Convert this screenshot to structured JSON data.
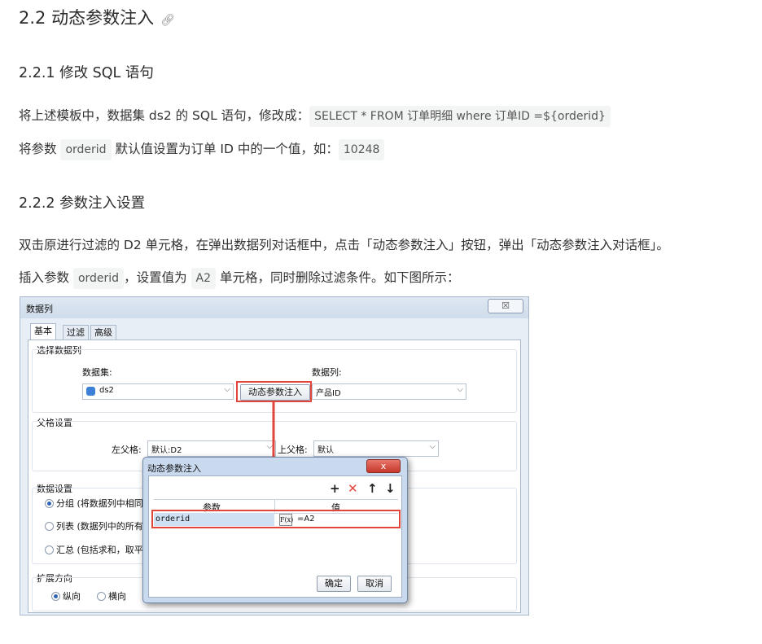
{
  "heading_2": "2.2 动态参数注入",
  "anchor_icon": "link-icon",
  "section_1": {
    "heading": "2.2.1 修改 SQL 语句",
    "line1_prefix": "将上述模板中，数据集 ds2 的 SQL 语句，修改成：",
    "line1_code": "SELECT * FROM 订单明细 where 订单ID =${orderid}",
    "line2_prefix": "将参数",
    "line2_code1": "orderid",
    "line2_middle": "默认值设置为订单 ID 中的一个值，如：",
    "line2_code2": "10248"
  },
  "section_2": {
    "heading": "2.2.2 参数注入设置",
    "line1": "双击原进行过滤的 D2 单元格，在弹出数据列对话框中，点击「动态参数注入」按钮，弹出「动态参数注入对话框」。",
    "line2_prefix": "插入参数",
    "line2_code1": "orderid",
    "line2_middle": "，设置值为",
    "line2_code2": "A2",
    "line2_suffix": "单元格，同时删除过滤条件。如下图所示："
  },
  "screenshot": {
    "window_title": "数据列",
    "close_label": "☒",
    "tabs": [
      "基本",
      "过滤",
      "高级"
    ],
    "select_group_title": "选择数据列",
    "dataset_label": "数据集:",
    "dataset_value": "ds2",
    "dynamic_param_button": "动态参数注入",
    "column_label": "数据列:",
    "column_value": "产品ID",
    "parent_group_title": "父格设置",
    "left_parent_label": "左父格:",
    "left_parent_value": "默认:D2",
    "top_parent_label": "上父格:",
    "top_parent_value": "默认",
    "data_settings_title": "数据设置",
    "radio_group": "分组 (将数据列中相同",
    "radio_list": "列表 (数据列中的所有",
    "radio_summary": "汇总 (包括求和，取平",
    "expand_title": "扩展方向",
    "radio_vertical": "纵向",
    "radio_horizontal": "横向",
    "dialog": {
      "title": "动态参数注入",
      "close_label": "x",
      "toolbar": [
        "+",
        "✕",
        "↑",
        "↓"
      ],
      "col_param": "参数",
      "col_value": "值",
      "row_param": "orderid",
      "row_value": "=A2",
      "fx_label": "F(x)",
      "ok": "确定",
      "cancel": "取消"
    }
  },
  "colors": {
    "highlight_red": "#e2453b",
    "code_bg": "#f3f4f4"
  }
}
